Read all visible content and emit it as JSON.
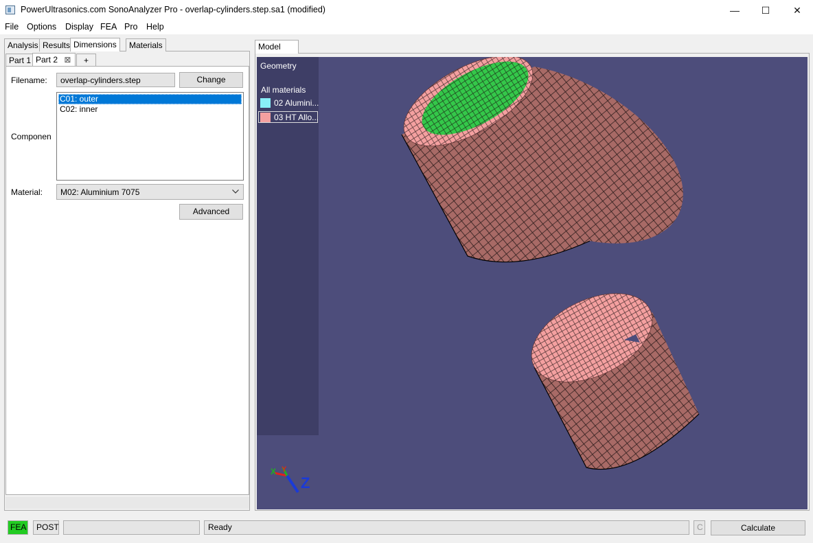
{
  "window": {
    "title": "PowerUltrasonics.com SonoAnalyzer Pro - overlap-cylinders.step.sa1 (modified)",
    "minimize": "—",
    "maximize": "☐",
    "close": "✕"
  },
  "menu": [
    "File",
    "Options",
    "Display",
    "FEA",
    "Pro",
    "Help"
  ],
  "left_tabs": [
    "Analysis",
    "Results",
    "Dimensions",
    "Materials"
  ],
  "part_tabs": {
    "part1": "Part 1",
    "part2": "Part 2",
    "close": "⊠",
    "add": "+"
  },
  "form": {
    "filename_label": "Filename:",
    "filename_value": "overlap-cylinders.step",
    "change_button": "Change",
    "component_label": "Componen",
    "components": [
      "C01: outer",
      "C02: inner"
    ],
    "material_label": "Material:",
    "material_value": "M02: Aluminium 7075",
    "advanced_button": "Advanced"
  },
  "viewport": {
    "tab": "Model",
    "legend_title": "Geometry",
    "legend_group": "All materials",
    "legend_items": [
      {
        "label": "02 Alumini...",
        "color": "#88f0f8"
      },
      {
        "label": "03 HT Allo...",
        "color": "#f4a0a0"
      }
    ],
    "axis_x": "X",
    "axis_y": "Y",
    "axis_z": "Z"
  },
  "status": {
    "fea": "FEA",
    "post": "POST",
    "message": "Ready",
    "c": "C",
    "calculate": "Calculate"
  },
  "colors": {
    "viewport_bg": "#4d4d7b",
    "mesh_pink": "#f4a0a0",
    "mesh_dark": "#a86a66",
    "mesh_green": "#34c84a",
    "fea_active": "#22cc22",
    "selection": "#0078d7"
  }
}
